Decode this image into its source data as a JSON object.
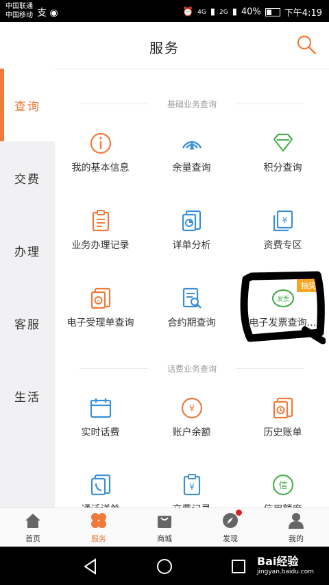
{
  "status": {
    "carrier1": "中国联通",
    "carrier2": "中国移动",
    "net1": "4G",
    "net2": "2G",
    "battery": "40%",
    "time": "下午4:19"
  },
  "header": {
    "title": "服务"
  },
  "sidebar": {
    "items": [
      {
        "label": "查询"
      },
      {
        "label": "交费"
      },
      {
        "label": "办理"
      },
      {
        "label": "客服"
      },
      {
        "label": "生活"
      }
    ]
  },
  "sections": {
    "basic": {
      "title": "基础业务查询",
      "items": [
        {
          "label": "我的基本信息"
        },
        {
          "label": "余量查询"
        },
        {
          "label": "积分查询"
        },
        {
          "label": "业务办理记录"
        },
        {
          "label": "详单分析"
        },
        {
          "label": "资费专区"
        },
        {
          "label": "电子受理单查询"
        },
        {
          "label": "合约期查询"
        },
        {
          "label": "电子发票查询…",
          "badge": "抽奖",
          "icon_text": "发票"
        }
      ]
    },
    "fee": {
      "title": "话费业务查询",
      "items": [
        {
          "label": "实时话费"
        },
        {
          "label": "账户余额"
        },
        {
          "label": "历史账单"
        },
        {
          "label": "通话详单",
          "icon_text": ""
        },
        {
          "label": "交费记录"
        },
        {
          "label": "信用额度",
          "icon_text": "信"
        }
      ]
    }
  },
  "tabbar": {
    "items": [
      {
        "label": "首页"
      },
      {
        "label": "服务"
      },
      {
        "label": "商城"
      },
      {
        "label": "发现"
      },
      {
        "label": "我的"
      }
    ]
  },
  "watermark": {
    "brand": "Bai经验",
    "url": "jingyan.baidu.com"
  },
  "colors": {
    "accent": "#f07a3a",
    "blue": "#3a8fd6",
    "green": "#4caf50",
    "red_dot": "#e02020",
    "badge": "#f5a623"
  }
}
